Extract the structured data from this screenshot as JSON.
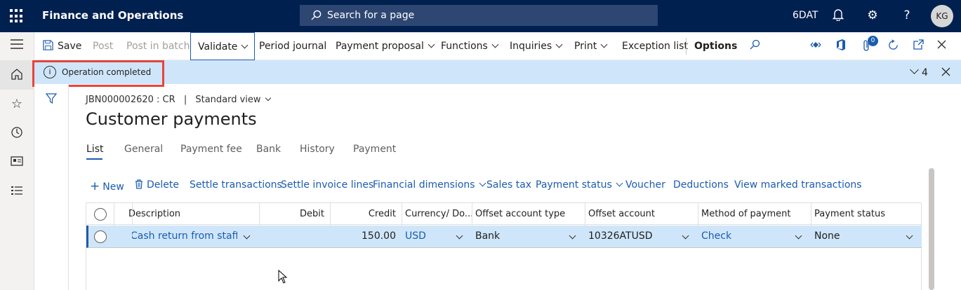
{
  "navbar": {
    "app_title": "Finance and Operations",
    "search_placeholder": "Search for a page",
    "company": "6DAT",
    "user_initials": "KG",
    "icons": [
      "waffle-icon",
      "search-icon",
      "bell-icon",
      "gear-icon",
      "help-icon"
    ]
  },
  "action_pane": {
    "save": "Save",
    "post": "Post",
    "post_in_batch": "Post in batch",
    "validate": "Validate",
    "period_journal": "Period journal",
    "payment_proposal": "Payment proposal",
    "functions": "Functions",
    "inquiries": "Inquiries",
    "print": "Print",
    "exception_list": "Exception list",
    "options": "Options",
    "attachments_count": "0"
  },
  "message_bar": {
    "text": "Operation completed",
    "count": "4"
  },
  "page": {
    "record": "JBN000002620 : CR",
    "separator": "|",
    "view": "Standard view",
    "title": "Customer payments"
  },
  "tabs": [
    "List",
    "General",
    "Payment fee",
    "Bank",
    "History",
    "Payment"
  ],
  "grid_toolbar": {
    "new": "New",
    "delete": "Delete",
    "settle_transactions": "Settle transactions",
    "settle_invoice_lines": "Settle invoice lines",
    "financial_dimensions": "Financial dimensions",
    "sales_tax": "Sales tax",
    "payment_status": "Payment status",
    "voucher": "Voucher",
    "deductions": "Deductions",
    "view_marked_transactions": "View marked transactions"
  },
  "grid": {
    "columns": [
      "Description",
      "Debit",
      "Credit",
      "Currency/ Do...",
      "Offset account type",
      "Offset account",
      "Method of payment",
      "Payment status"
    ],
    "rows": [
      {
        "description": "Cash return from staff",
        "debit": "",
        "credit": "150.00",
        "currency": "USD",
        "offset_account_type": "Bank",
        "offset_account": "10326ATUSD",
        "method_of_payment": "Check",
        "payment_status": "None"
      }
    ]
  },
  "colors": {
    "navbar": "#002050",
    "accent": "#1c5bb0",
    "message_bar": "#cfe6fa",
    "highlight": "#e8443a"
  }
}
